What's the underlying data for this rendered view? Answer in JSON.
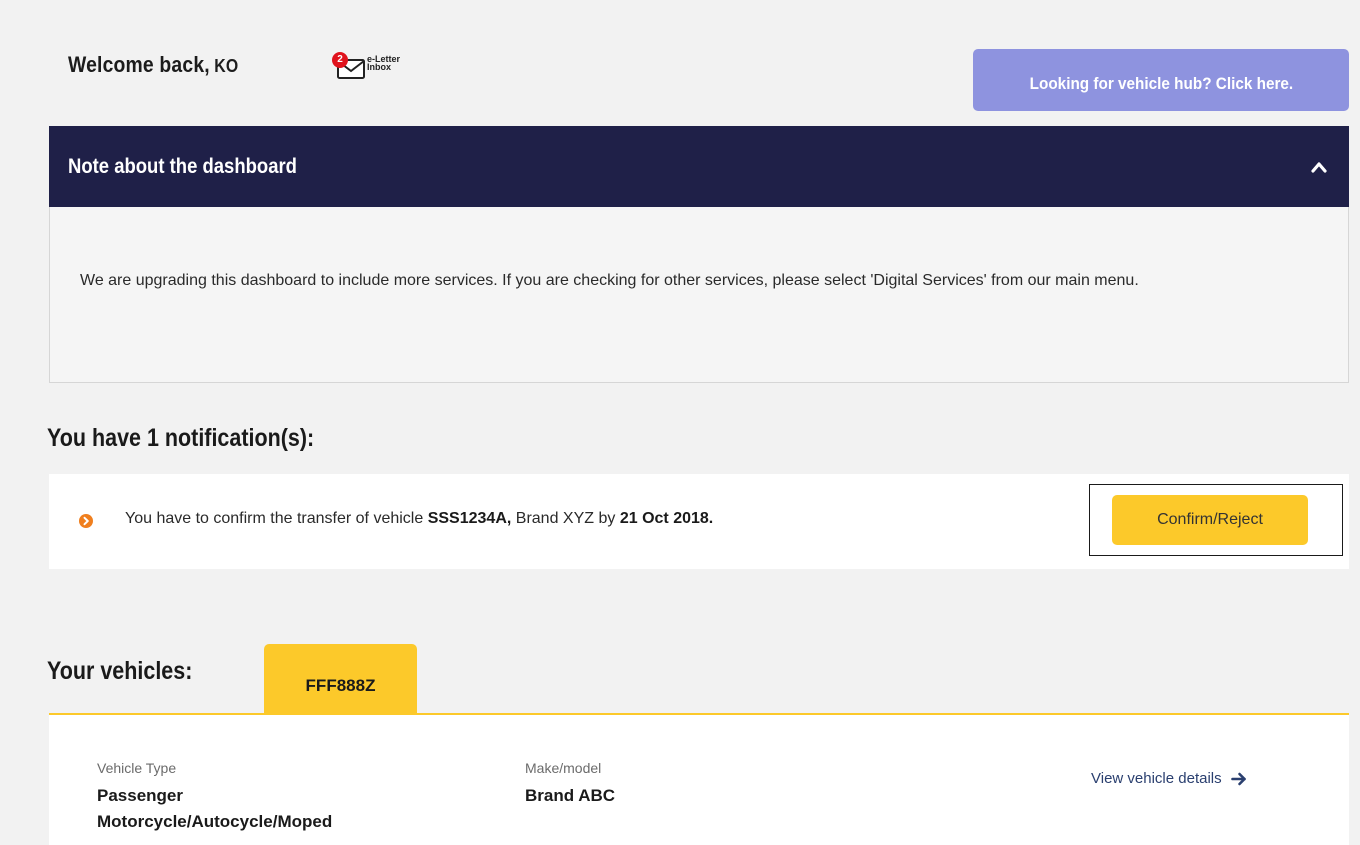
{
  "header": {
    "welcome_text": "Welcome back,",
    "user_name": "KO",
    "eletter_badge_count": "2",
    "eletter_label_line1": "e-Letter",
    "eletter_label_line2": "Inbox",
    "hub_button_label": "Looking for vehicle hub? Click here."
  },
  "note": {
    "title": "Note about the dashboard",
    "body": "We are upgrading this dashboard to include more services. If you are checking for other services, please select 'Digital Services' from our main menu.",
    "toggle_icon": "chevron-up-icon"
  },
  "notifications": {
    "heading": "You have 1 notification(s):",
    "items": [
      {
        "text_prefix": "You have to confirm the transfer of vehicle",
        "vehicle_no": "SSS1234A,",
        "brand_text": "Brand XYZ by",
        "due_date": "21 Oct 2018.",
        "action_label": "Confirm/Reject"
      }
    ]
  },
  "vehicles": {
    "heading": "Your vehicles:",
    "tabs": [
      {
        "label": "FFF888Z"
      }
    ],
    "selected": {
      "type_label": "Vehicle Type",
      "type_value_line1": "Passenger",
      "type_value_line2": "Motorcycle/Autocycle/Moped",
      "make_label": "Make/model",
      "make_value": "Brand ABC",
      "view_link_label": "View vehicle details"
    }
  },
  "colors": {
    "accent_yellow": "#fcc92a",
    "navy": "#1f2048",
    "hub_button": "#8e93df",
    "notification_icon": "#f07f1e",
    "badge_red": "#e0131d"
  }
}
